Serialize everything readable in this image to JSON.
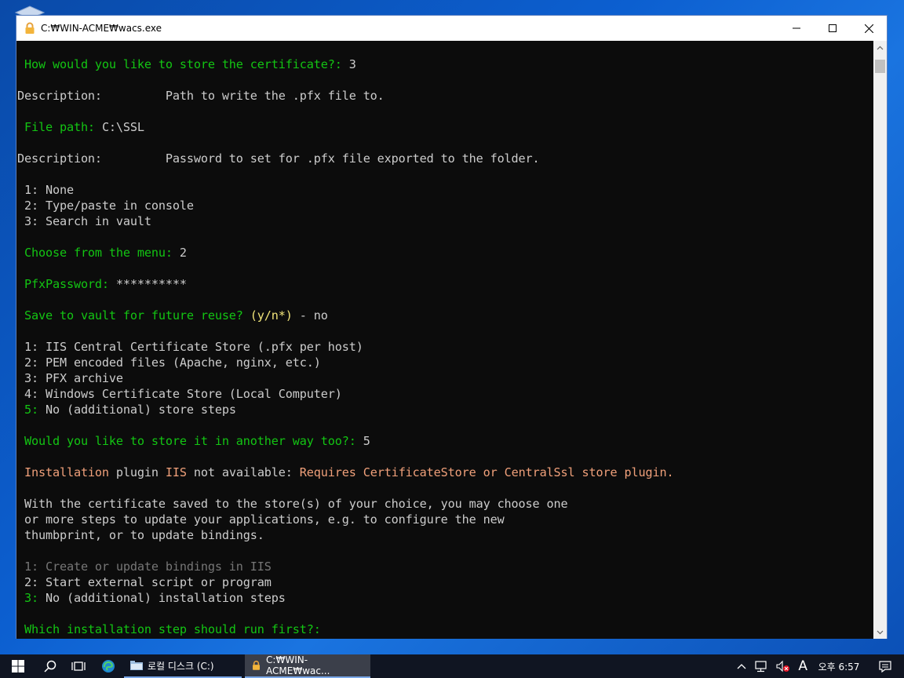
{
  "window": {
    "title": "C:₩WIN-ACME₩wacs.exe"
  },
  "console": {
    "lines": [
      [
        {
          "t": " How would you like to store the certificate?: ",
          "c": "g"
        },
        {
          "t": "3",
          "c": "w"
        }
      ],
      [],
      [
        {
          "t": "Description:         Path to write the .pfx file to.",
          "c": "w"
        }
      ],
      [],
      [
        {
          "t": " File path: ",
          "c": "g"
        },
        {
          "t": "C:\\SSL",
          "c": "w"
        }
      ],
      [],
      [
        {
          "t": "Description:         Password to set for .pfx file exported to the folder.",
          "c": "w"
        }
      ],
      [],
      [
        {
          "t": " 1: None",
          "c": "w"
        }
      ],
      [
        {
          "t": " 2: Type/paste in console",
          "c": "w"
        }
      ],
      [
        {
          "t": " 3: Search in vault",
          "c": "w"
        }
      ],
      [],
      [
        {
          "t": " Choose from the menu: ",
          "c": "g"
        },
        {
          "t": "2",
          "c": "w"
        }
      ],
      [],
      [
        {
          "t": " PfxPassword: ",
          "c": "g"
        },
        {
          "t": "**********",
          "c": "w"
        }
      ],
      [],
      [
        {
          "t": " Save to vault for future reuse? ",
          "c": "g"
        },
        {
          "t": "(y/n*)",
          "c": "y"
        },
        {
          "t": " - no",
          "c": "w"
        }
      ],
      [],
      [
        {
          "t": " 1: IIS Central Certificate Store (.pfx per host)",
          "c": "w"
        }
      ],
      [
        {
          "t": " 2: PEM encoded files (Apache, nginx, etc.)",
          "c": "w"
        }
      ],
      [
        {
          "t": " 3: PFX archive",
          "c": "w"
        }
      ],
      [
        {
          "t": " 4: Windows Certificate Store (Local Computer)",
          "c": "w"
        }
      ],
      [
        {
          "t": " 5: ",
          "c": "g"
        },
        {
          "t": "No (additional) store steps",
          "c": "w"
        }
      ],
      [],
      [
        {
          "t": " Would you like to store it in another way too?: ",
          "c": "g"
        },
        {
          "t": "5",
          "c": "w"
        }
      ],
      [],
      [
        {
          "t": " Installation ",
          "c": "o"
        },
        {
          "t": "plugin ",
          "c": "w"
        },
        {
          "t": "IIS ",
          "c": "o"
        },
        {
          "t": "not available: ",
          "c": "w"
        },
        {
          "t": "Requires CertificateStore or CentralSsl store plugin.",
          "c": "o"
        }
      ],
      [],
      [
        {
          "t": " With the certificate saved to the store(s) of your choice, you may choose one",
          "c": "w"
        }
      ],
      [
        {
          "t": " or more steps to update your applications, e.g. to configure the new",
          "c": "w"
        }
      ],
      [
        {
          "t": " thumbprint, or to update bindings.",
          "c": "w"
        }
      ],
      [],
      [
        {
          "t": " 1: Create or update bindings in IIS",
          "c": "gray"
        }
      ],
      [
        {
          "t": " 2: Start external script or program",
          "c": "w"
        }
      ],
      [
        {
          "t": " 3: ",
          "c": "g"
        },
        {
          "t": "No (additional) installation steps",
          "c": "w"
        }
      ],
      [],
      [
        {
          "t": " Which installation step should run first?: ",
          "c": "g"
        }
      ]
    ]
  },
  "taskbar": {
    "apps": [
      {
        "label": "로컬 디스크 (C:)",
        "icon": "file-explorer-icon"
      },
      {
        "label": "C:₩WIN-ACME₩wac...",
        "icon": "lock-icon"
      }
    ],
    "ime": "A",
    "clock": "오후 6:57"
  },
  "colors": {
    "console_bg": "#0c0c0c",
    "green": "#13c513",
    "white": "#cccccc",
    "yellow": "#f2e57a",
    "orange": "#f0a07a",
    "gray": "#767676",
    "taskbar": "#101522"
  }
}
